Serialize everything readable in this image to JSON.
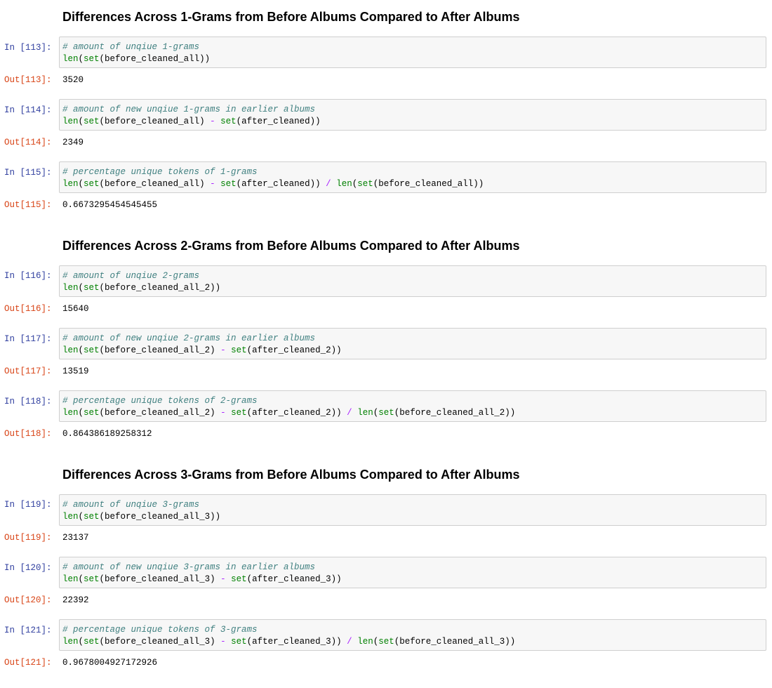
{
  "headings": [
    "Differences Across 1-Grams from Before Albums Compared to After Albums",
    "Differences Across 2-Grams from Before Albums Compared to After Albums",
    "Differences Across 3-Grams from Before Albums Compared to After Albums"
  ],
  "cells": [
    {
      "in_prompt": "In [113]:",
      "out_prompt": "Out[113]:",
      "comment": "# amount of unqiue 1-grams",
      "code": [
        {
          "t": "builtin",
          "v": "len"
        },
        {
          "t": "plain",
          "v": "("
        },
        {
          "t": "builtin",
          "v": "set"
        },
        {
          "t": "plain",
          "v": "(before_cleaned_all))"
        }
      ],
      "output": "3520"
    },
    {
      "in_prompt": "In [114]:",
      "out_prompt": "Out[114]:",
      "comment": "# amount of new unqiue 1-grams in earlier albums",
      "code": [
        {
          "t": "builtin",
          "v": "len"
        },
        {
          "t": "plain",
          "v": "("
        },
        {
          "t": "builtin",
          "v": "set"
        },
        {
          "t": "plain",
          "v": "(before_cleaned_all) "
        },
        {
          "t": "op",
          "v": "-"
        },
        {
          "t": "plain",
          "v": " "
        },
        {
          "t": "builtin",
          "v": "set"
        },
        {
          "t": "plain",
          "v": "(after_cleaned))"
        }
      ],
      "output": "2349"
    },
    {
      "in_prompt": "In [115]:",
      "out_prompt": "Out[115]:",
      "comment": "# percentage unique tokens of 1-grams",
      "code": [
        {
          "t": "builtin",
          "v": "len"
        },
        {
          "t": "plain",
          "v": "("
        },
        {
          "t": "builtin",
          "v": "set"
        },
        {
          "t": "plain",
          "v": "(before_cleaned_all) "
        },
        {
          "t": "op",
          "v": "-"
        },
        {
          "t": "plain",
          "v": " "
        },
        {
          "t": "builtin",
          "v": "set"
        },
        {
          "t": "plain",
          "v": "(after_cleaned)) "
        },
        {
          "t": "op",
          "v": "/"
        },
        {
          "t": "plain",
          "v": " "
        },
        {
          "t": "builtin",
          "v": "len"
        },
        {
          "t": "plain",
          "v": "("
        },
        {
          "t": "builtin",
          "v": "set"
        },
        {
          "t": "plain",
          "v": "(before_cleaned_all))"
        }
      ],
      "output": "0.6673295454545455"
    },
    {
      "in_prompt": "In [116]:",
      "out_prompt": "Out[116]:",
      "comment": "# amount of unqiue 2-grams",
      "code": [
        {
          "t": "builtin",
          "v": "len"
        },
        {
          "t": "plain",
          "v": "("
        },
        {
          "t": "builtin",
          "v": "set"
        },
        {
          "t": "plain",
          "v": "(before_cleaned_all_2))"
        }
      ],
      "output": "15640"
    },
    {
      "in_prompt": "In [117]:",
      "out_prompt": "Out[117]:",
      "comment": "# amount of new unqiue 2-grams in earlier albums",
      "code": [
        {
          "t": "builtin",
          "v": "len"
        },
        {
          "t": "plain",
          "v": "("
        },
        {
          "t": "builtin",
          "v": "set"
        },
        {
          "t": "plain",
          "v": "(before_cleaned_all_2) "
        },
        {
          "t": "op",
          "v": "-"
        },
        {
          "t": "plain",
          "v": " "
        },
        {
          "t": "builtin",
          "v": "set"
        },
        {
          "t": "plain",
          "v": "(after_cleaned_2))"
        }
      ],
      "output": "13519"
    },
    {
      "in_prompt": "In [118]:",
      "out_prompt": "Out[118]:",
      "comment": "# percentage unique tokens of 2-grams",
      "code": [
        {
          "t": "builtin",
          "v": "len"
        },
        {
          "t": "plain",
          "v": "("
        },
        {
          "t": "builtin",
          "v": "set"
        },
        {
          "t": "plain",
          "v": "(before_cleaned_all_2) "
        },
        {
          "t": "op",
          "v": "-"
        },
        {
          "t": "plain",
          "v": " "
        },
        {
          "t": "builtin",
          "v": "set"
        },
        {
          "t": "plain",
          "v": "(after_cleaned_2)) "
        },
        {
          "t": "op",
          "v": "/"
        },
        {
          "t": "plain",
          "v": " "
        },
        {
          "t": "builtin",
          "v": "len"
        },
        {
          "t": "plain",
          "v": "("
        },
        {
          "t": "builtin",
          "v": "set"
        },
        {
          "t": "plain",
          "v": "(before_cleaned_all_2))"
        }
      ],
      "output": "0.864386189258312"
    },
    {
      "in_prompt": "In [119]:",
      "out_prompt": "Out[119]:",
      "comment": "# amount of unqiue 3-grams",
      "code": [
        {
          "t": "builtin",
          "v": "len"
        },
        {
          "t": "plain",
          "v": "("
        },
        {
          "t": "builtin",
          "v": "set"
        },
        {
          "t": "plain",
          "v": "(before_cleaned_all_3))"
        }
      ],
      "output": "23137"
    },
    {
      "in_prompt": "In [120]:",
      "out_prompt": "Out[120]:",
      "comment": "# amount of new unqiue 3-grams in earlier albums",
      "code": [
        {
          "t": "builtin",
          "v": "len"
        },
        {
          "t": "plain",
          "v": "("
        },
        {
          "t": "builtin",
          "v": "set"
        },
        {
          "t": "plain",
          "v": "(before_cleaned_all_3) "
        },
        {
          "t": "op",
          "v": "-"
        },
        {
          "t": "plain",
          "v": " "
        },
        {
          "t": "builtin",
          "v": "set"
        },
        {
          "t": "plain",
          "v": "(after_cleaned_3))"
        }
      ],
      "output": "22392"
    },
    {
      "in_prompt": "In [121]:",
      "out_prompt": "Out[121]:",
      "comment": "# percentage unique tokens of 3-grams",
      "code": [
        {
          "t": "builtin",
          "v": "len"
        },
        {
          "t": "plain",
          "v": "("
        },
        {
          "t": "builtin",
          "v": "set"
        },
        {
          "t": "plain",
          "v": "(before_cleaned_all_3) "
        },
        {
          "t": "op",
          "v": "-"
        },
        {
          "t": "plain",
          "v": " "
        },
        {
          "t": "builtin",
          "v": "set"
        },
        {
          "t": "plain",
          "v": "(after_cleaned_3)) "
        },
        {
          "t": "op",
          "v": "/"
        },
        {
          "t": "plain",
          "v": " "
        },
        {
          "t": "builtin",
          "v": "len"
        },
        {
          "t": "plain",
          "v": "("
        },
        {
          "t": "builtin",
          "v": "set"
        },
        {
          "t": "plain",
          "v": "(before_cleaned_all_3))"
        }
      ],
      "output": "0.9678004927172926"
    }
  ]
}
